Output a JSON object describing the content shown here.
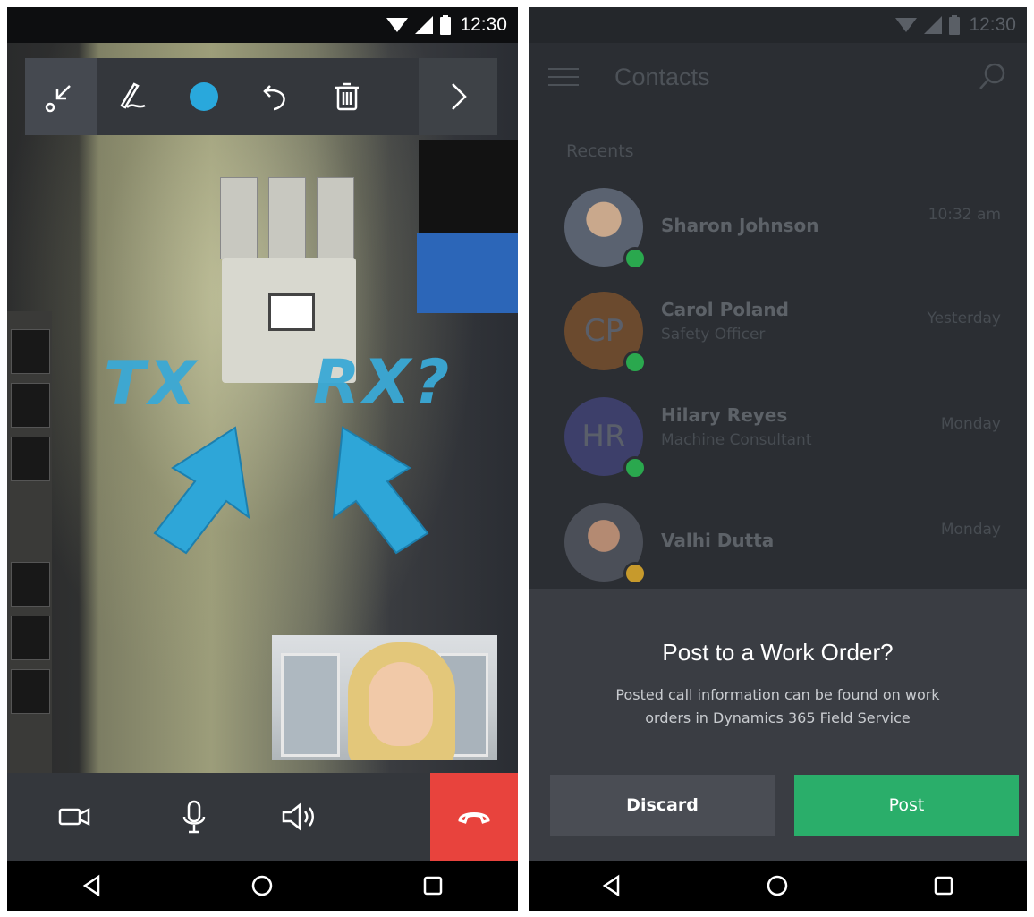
{
  "status_bar": {
    "time": "12:30"
  },
  "left_phone": {
    "toolbar": {
      "tools": [
        "collapse-arrow-icon",
        "pen-icon",
        "color-picker",
        "undo-icon",
        "trash-icon",
        "chevron-right-icon"
      ],
      "active_color": "#29a8dc"
    },
    "annotations": {
      "tx": "TX",
      "rx": "RX?"
    },
    "call_bar": {
      "buttons": [
        "video-camera-icon",
        "microphone-icon",
        "speaker-icon",
        "end-call-icon"
      ],
      "end_call_color": "#e8433d"
    }
  },
  "right_phone": {
    "header": {
      "title": "Contacts"
    },
    "recents_label": "Recents",
    "contacts": [
      {
        "name": "Sharon Johnson",
        "role": "",
        "time": "10:32 am",
        "initials": "",
        "presence": "available"
      },
      {
        "name": "Carol Poland",
        "role": "Safety Officer",
        "time": "Yesterday",
        "initials": "CP",
        "presence": "available"
      },
      {
        "name": "Hilary Reyes",
        "role": "Machine Consultant",
        "time": "Monday",
        "initials": "HR",
        "presence": "available"
      },
      {
        "name": "Valhi Dutta",
        "role": "",
        "time": "Monday",
        "initials": "",
        "presence": "away"
      }
    ],
    "dialog": {
      "title": "Post to a Work Order?",
      "body": "Posted call information can be found on work orders in Dynamics 365 Field Service",
      "discard_label": "Discard",
      "post_label": "Post",
      "post_color": "#2aae6a"
    }
  }
}
